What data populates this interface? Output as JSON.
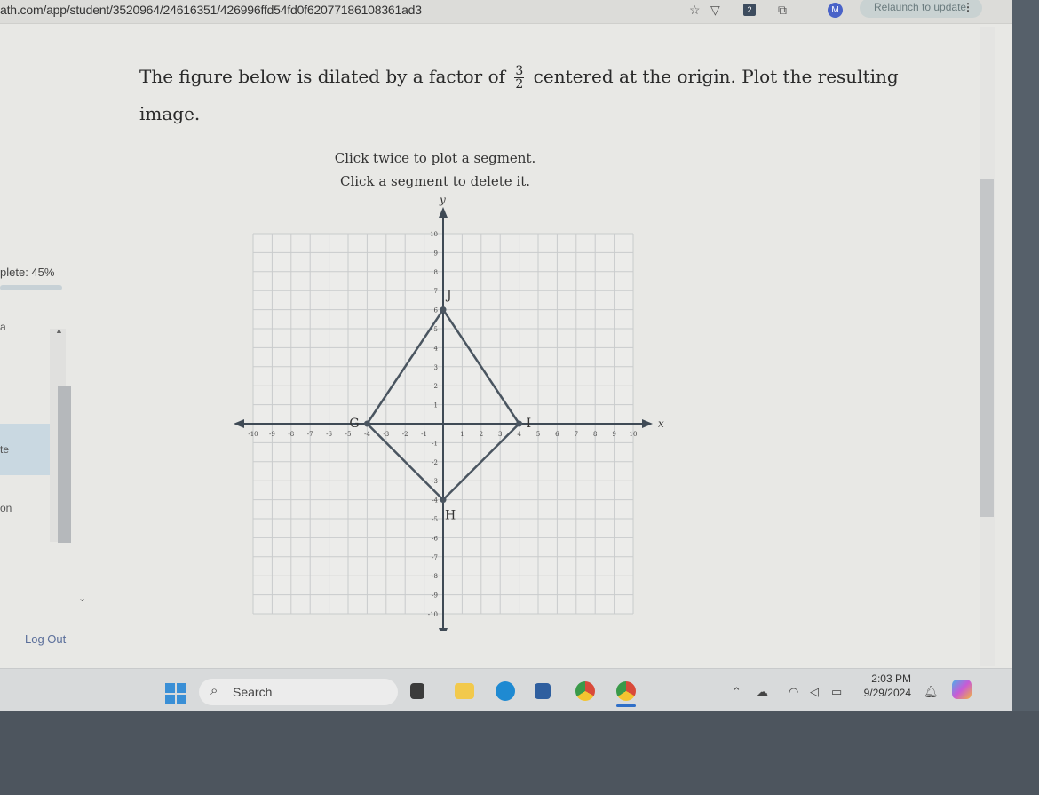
{
  "browser": {
    "url": "ath.com/app/student/3520964/24616351/426996ffd54fd0f62077186108361ad3",
    "profile_initial": "M",
    "extension_badge": "2",
    "relaunch_label": "Relaunch to update",
    "menu_glyph": "⋮",
    "star_glyph": "☆",
    "shield_glyph": "▽",
    "puzzle_glyph": "⧉"
  },
  "question": {
    "text_before": "The figure below is dilated by a factor of",
    "fraction_numerator": "3",
    "fraction_denominator": "2",
    "text_after": "centered at the origin. Plot the resulting image."
  },
  "instructions": {
    "line1": "Click twice to plot a segment.",
    "line2": "Click a segment to delete it."
  },
  "sidebar": {
    "progress_label": "plete: 45%",
    "progress_percent": 45,
    "items": [
      {
        "label": "a",
        "active": false
      },
      {
        "label": "te",
        "active": true
      },
      {
        "label": "on",
        "active": false
      }
    ],
    "logout_label": "Log Out"
  },
  "chart_data": {
    "type": "scatter",
    "title": "",
    "xlabel": "x",
    "ylabel": "y",
    "xlim": [
      -10,
      10
    ],
    "ylim": [
      -10,
      10
    ],
    "grid": true,
    "x_ticks": [
      -10,
      -9,
      -8,
      -7,
      -6,
      -5,
      -4,
      -3,
      -2,
      -1,
      1,
      2,
      3,
      4,
      5,
      6,
      7,
      8,
      9,
      10
    ],
    "y_ticks": [
      -10,
      -9,
      -8,
      -7,
      -6,
      -5,
      -4,
      -3,
      -2,
      -1,
      1,
      2,
      3,
      4,
      5,
      6,
      7,
      8,
      9,
      10
    ],
    "points": [
      {
        "label": "G",
        "x": -4,
        "y": 0
      },
      {
        "label": "J",
        "x": 0,
        "y": 6
      },
      {
        "label": "I",
        "x": 4,
        "y": 0
      },
      {
        "label": "H",
        "x": 0,
        "y": -4
      }
    ],
    "segments": [
      [
        "G",
        "J"
      ],
      [
        "J",
        "I"
      ],
      [
        "I",
        "H"
      ],
      [
        "H",
        "G"
      ]
    ],
    "colors": {
      "figure": "#4a5560",
      "grid": "#c9cbcc",
      "axis": "#3f4a55"
    }
  },
  "taskbar": {
    "search_label": "Search",
    "time": "2:03 PM",
    "date": "9/29/2024",
    "tray_icons": [
      "chevron-up-icon",
      "cloud-icon",
      "wifi-icon",
      "volume-icon",
      "battery-icon"
    ],
    "apps": [
      "task-view",
      "file-explorer",
      "edge",
      "store",
      "chrome-profile-1",
      "chrome-profile-m"
    ]
  }
}
